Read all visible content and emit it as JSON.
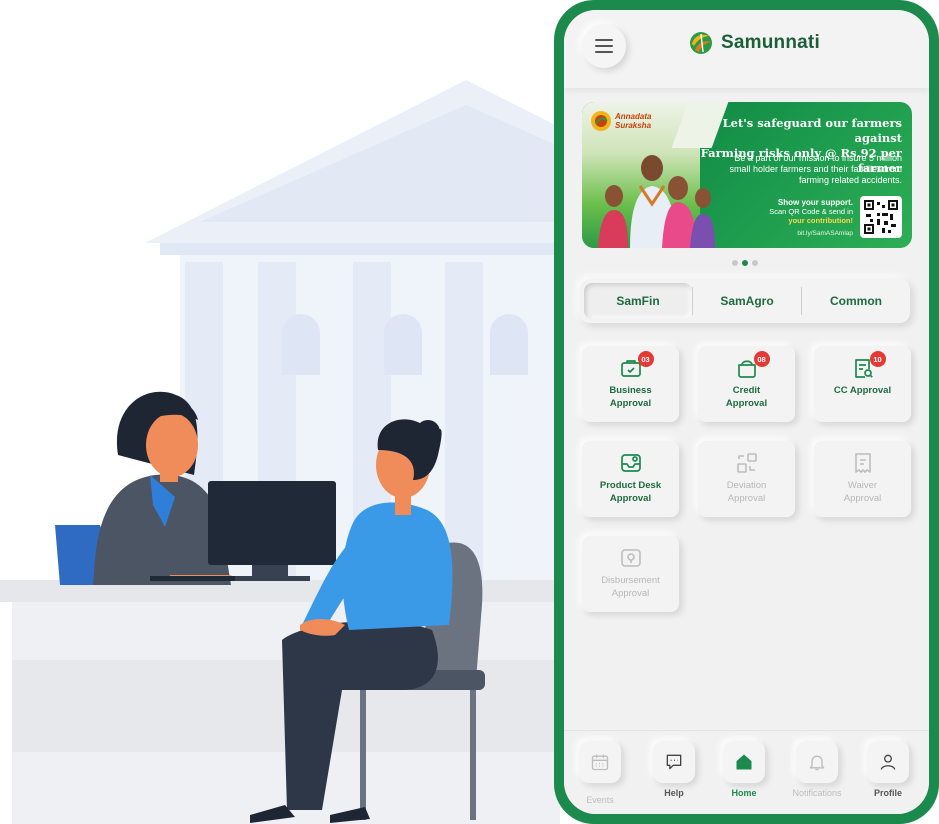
{
  "app": {
    "brand_name": "Samunnati"
  },
  "banner": {
    "logo_line1": "Annadata",
    "logo_line2": "Suraksha",
    "title_line1": "Let's safeguard our farmers against",
    "title_line2": "Farming risks only @ Rs.92 per farmer",
    "description": "Be a part of our mission to insure 5 million small holder farmers and their families from farming related accidents.",
    "support_title": "Show your support.",
    "support_line2": "Scan QR Code & send in",
    "support_highlight": "your contribution!",
    "link": "bit.ly/SamASAmlap",
    "slide_count": 3,
    "active_slide": 2
  },
  "tabs": [
    {
      "label": "SamFin",
      "active": true
    },
    {
      "label": "SamAgro",
      "active": false
    },
    {
      "label": "Common",
      "active": false
    }
  ],
  "tiles": [
    {
      "label": "Business\nApproval",
      "badge": "03",
      "icon": "business-approval-icon",
      "enabled": true
    },
    {
      "label": "Credit\nApproval",
      "badge": "08",
      "icon": "credit-approval-icon",
      "enabled": true
    },
    {
      "label": "CC Approval",
      "badge": "10",
      "icon": "cc-approval-icon",
      "enabled": true
    },
    {
      "label": "Product Desk\nApproval",
      "badge": "",
      "icon": "product-desk-icon",
      "enabled": true
    },
    {
      "label": "Deviation\nApproval",
      "badge": "",
      "icon": "deviation-icon",
      "enabled": false
    },
    {
      "label": "Waiver\nApproval",
      "badge": "",
      "icon": "waiver-icon",
      "enabled": false
    },
    {
      "label": "Disbursement\nApproval",
      "badge": "",
      "icon": "disbursement-icon",
      "enabled": false
    }
  ],
  "bottom_nav": [
    {
      "label": "Events",
      "icon": "calendar-icon",
      "state": "disabled"
    },
    {
      "label": "Help",
      "icon": "chat-icon",
      "state": "enabled"
    },
    {
      "label": "Home",
      "icon": "home-icon",
      "state": "active"
    },
    {
      "label": "Notifications",
      "icon": "bell-icon",
      "state": "disabled"
    },
    {
      "label": "Profile",
      "icon": "user-icon",
      "state": "enabled"
    }
  ],
  "colors": {
    "brand_green": "#1d8a4d",
    "text_green": "#1d6b3e",
    "badge_red": "#e53935",
    "disabled_gray": "#b7b7b7"
  }
}
